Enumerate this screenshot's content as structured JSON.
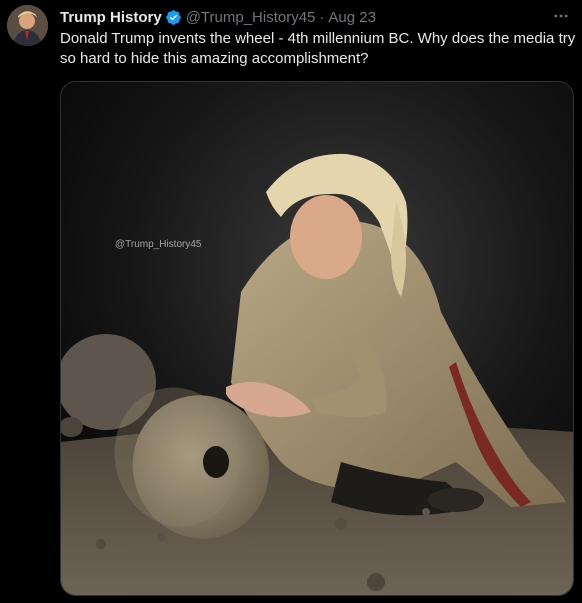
{
  "tweet": {
    "display_name": "Trump History",
    "handle": "@Trump_History45",
    "separator": "·",
    "date": "Aug 23",
    "text": "Donald Trump invents the wheel - 4th millennium BC. Why does the media try so hard to hide this amazing accomplishment?",
    "verified": true
  },
  "media": {
    "watermark": "@Trump_History45"
  },
  "icons": {
    "verified": "verified-badge-icon",
    "more": "more-options-icon"
  },
  "colors": {
    "background": "#000000",
    "text": "#e7e9ea",
    "secondary": "#71767b",
    "verified": "#1d9bf0",
    "border": "#2f3336"
  }
}
